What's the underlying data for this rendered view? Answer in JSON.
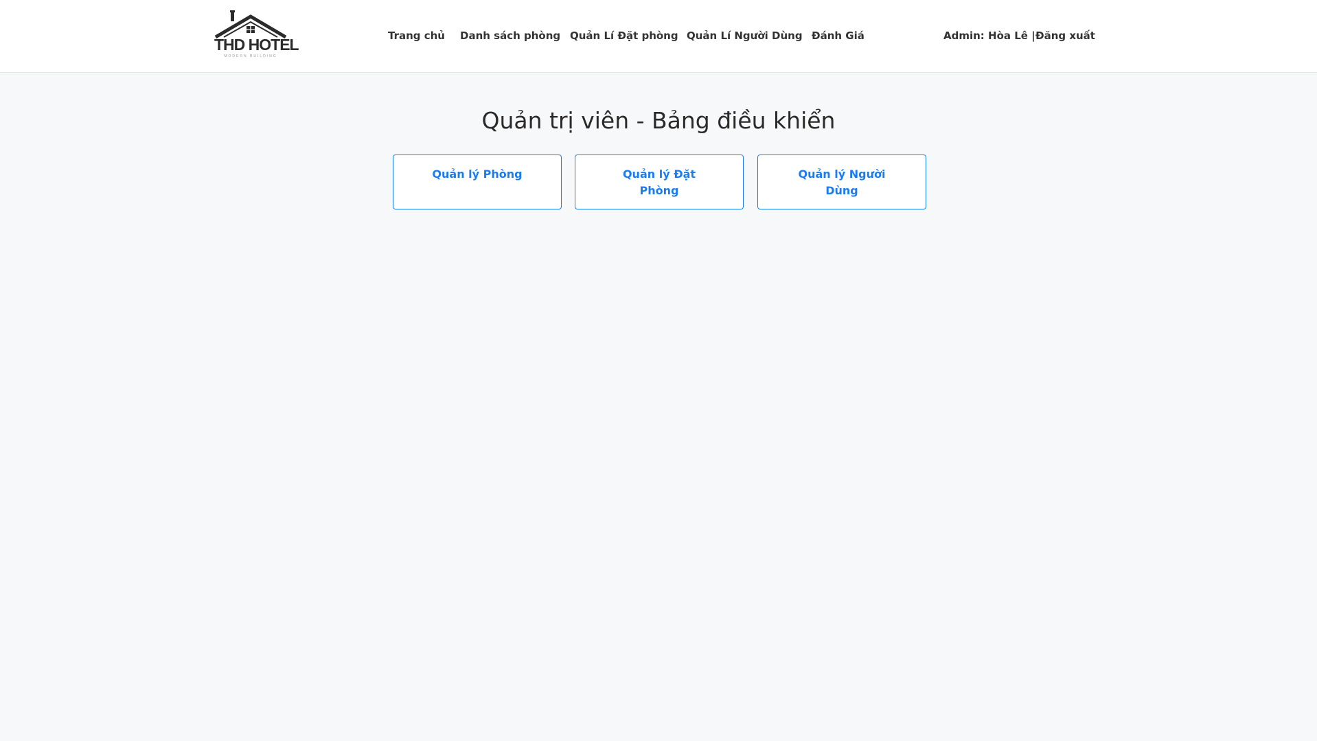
{
  "brand": {
    "name": "THD HOTEL",
    "tagline": "MODERN BUILDING"
  },
  "nav": {
    "items": [
      {
        "label": "Trang chủ"
      },
      {
        "label": "Danh sách phòng"
      },
      {
        "label": "Quản Lí Đặt phòng"
      },
      {
        "label": "Quản Lí Người Dùng"
      },
      {
        "label": "Đánh Giá"
      }
    ]
  },
  "user": {
    "admin_label": "Admin: Hòa Lê |",
    "logout_label": "Đăng xuất"
  },
  "page": {
    "title": "Quản trị viên - Bảng điều khiển"
  },
  "cards": [
    {
      "label": "Quản lý Phòng"
    },
    {
      "label": "Quản lý Đặt Phòng"
    },
    {
      "label": "Quản lý Người Dùng"
    }
  ],
  "colors": {
    "accent": "#1a7cf2",
    "background": "#f7f8f9",
    "header": "#ffffff",
    "nav_text": "#333333"
  }
}
